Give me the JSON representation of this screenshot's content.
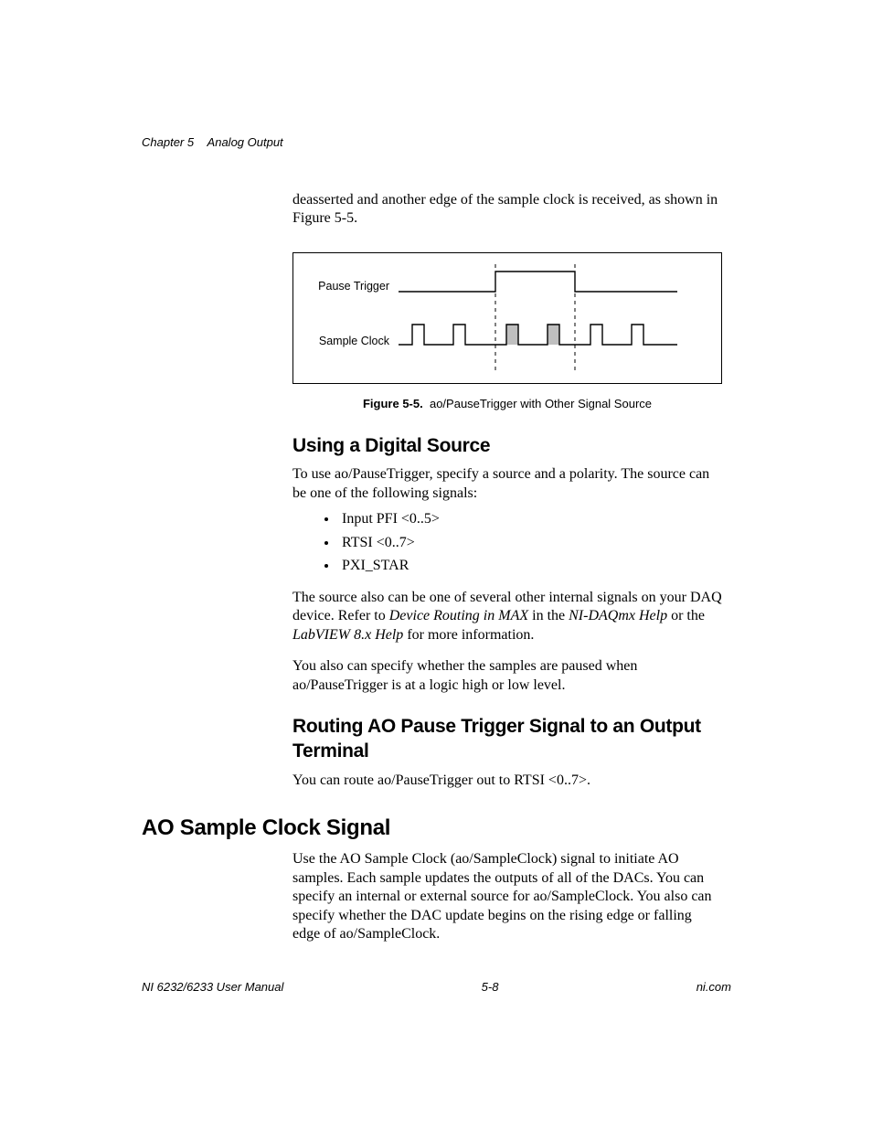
{
  "header": {
    "chapter": "Chapter 5",
    "title": "Analog Output"
  },
  "body": {
    "intro_para": "deasserted and another edge of the sample clock is received, as shown in Figure 5-5.",
    "figure": {
      "label_pause": "Pause Trigger",
      "label_clock": "Sample Clock",
      "caption_bold": "Figure 5-5.",
      "caption_text": "ao/PauseTrigger with Other Signal Source"
    },
    "sec1": {
      "heading": "Using a Digital Source",
      "p1": "To use ao/PauseTrigger, specify a source and a polarity. The source can be one of the following signals:",
      "bullets": [
        "Input PFI <0..5>",
        "RTSI <0..7>",
        "PXI_STAR"
      ],
      "p2a": "The source also can be one of several other internal signals on your DAQ device. Refer to ",
      "p2b": "Device Routing in MAX",
      "p2c": " in the ",
      "p2d": "NI-DAQmx Help",
      "p2e": " or the ",
      "p2f": "LabVIEW 8.x Help",
      "p2g": " for more information.",
      "p3": "You also can specify whether the samples are paused when ao/PauseTrigger is at a logic high or low level."
    },
    "sec2": {
      "heading": "Routing AO Pause Trigger Signal to an Output Terminal",
      "p1": "You can route ao/PauseTrigger out to RTSI <0..7>."
    },
    "sec3": {
      "heading": "AO Sample Clock Signal",
      "p1": "Use the AO Sample Clock (ao/SampleClock) signal to initiate AO samples. Each sample updates the outputs of all of the DACs. You can specify an internal or external source for ao/SampleClock. You also can specify whether the DAC update begins on the rising edge or falling edge of ao/SampleClock."
    }
  },
  "footer": {
    "left": "NI 6232/6233 User Manual",
    "center": "5-8",
    "right": "ni.com"
  }
}
